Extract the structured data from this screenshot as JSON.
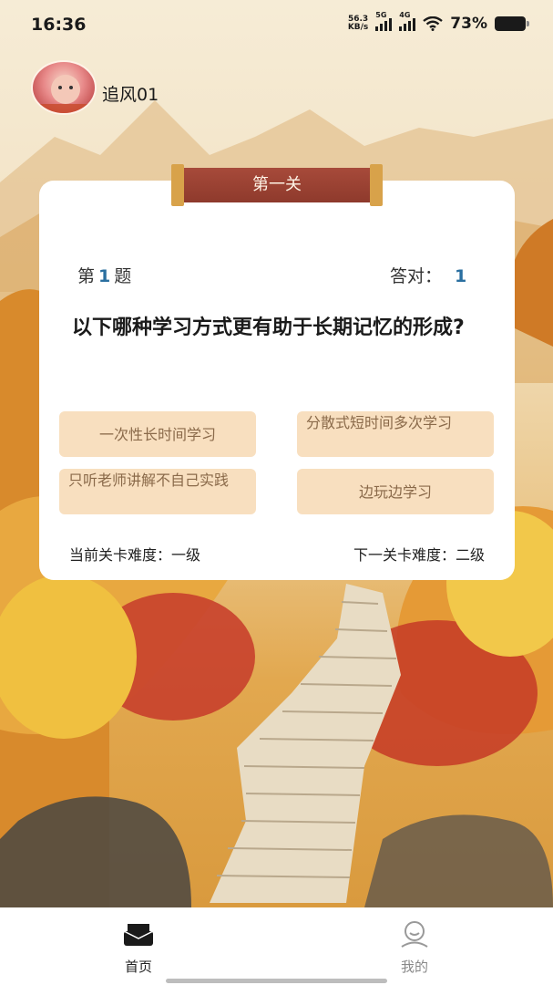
{
  "status_bar": {
    "time": "16:36",
    "net_speed_value": "56.3",
    "net_speed_unit": "KB/s",
    "sim1_label": "5G",
    "sim2_label": "4G",
    "battery_percent": "73%"
  },
  "user": {
    "name": "追风01"
  },
  "level": {
    "title": "第一关"
  },
  "quiz": {
    "question_prefix": "第",
    "question_number": "1",
    "question_suffix": "题",
    "correct_label": "答对：",
    "correct_count": "1",
    "question_text": "以下哪种学习方式更有助于长期记忆的形成?",
    "options": [
      {
        "text": "一次性长时间学习"
      },
      {
        "text": "分散式短时间多次学习"
      },
      {
        "text": "只听老师讲解不自己实践"
      },
      {
        "text": "边玩边学习"
      }
    ],
    "current_difficulty": "当前关卡难度：一级",
    "next_difficulty": "下一关卡难度：二级"
  },
  "tabbar": {
    "home_label": "首页",
    "mine_label": "我的"
  },
  "colors": {
    "banner": "#9a4232",
    "banner_tip": "#d8a24a",
    "option_bg": "#f8dfbf",
    "option_text": "#8a6a4a",
    "accent_number": "#2a6fa0"
  }
}
